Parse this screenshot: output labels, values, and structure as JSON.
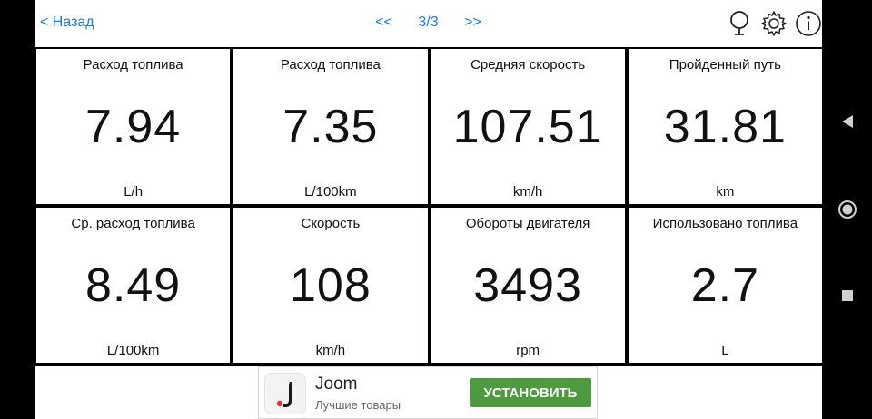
{
  "header": {
    "back_label": "< Назад",
    "prev_label": "<<",
    "page_indicator": "3/3",
    "next_label": ">>",
    "icons": [
      "microphone-icon",
      "gear-icon",
      "info-icon"
    ]
  },
  "tiles": [
    {
      "title": "Расход топлива",
      "value": "7.94",
      "unit": "L/h"
    },
    {
      "title": "Расход топлива",
      "value": "7.35",
      "unit": "L/100km"
    },
    {
      "title": "Средняя скорость",
      "value": "107.51",
      "unit": "km/h"
    },
    {
      "title": "Пройденный путь",
      "value": "31.81",
      "unit": "km"
    },
    {
      "title": "Ср. расход топлива",
      "value": "8.49",
      "unit": "L/100km"
    },
    {
      "title": "Скорость",
      "value": "108",
      "unit": "km/h"
    },
    {
      "title": "Обороты двигателя",
      "value": "3493",
      "unit": "rpm"
    },
    {
      "title": "Использовано топлива",
      "value": "2.7",
      "unit": "L"
    }
  ],
  "ad": {
    "name": "Joom",
    "subtitle": "Лучшие товары",
    "cta": "УСТАНОВИТЬ",
    "cta_color": "#4e9a3f"
  },
  "android_nav": [
    "back-triangle-icon",
    "home-circle-icon",
    "recents-square-icon"
  ],
  "colors": {
    "accent": "#1e7bd6",
    "grid_lines": "#000000"
  }
}
